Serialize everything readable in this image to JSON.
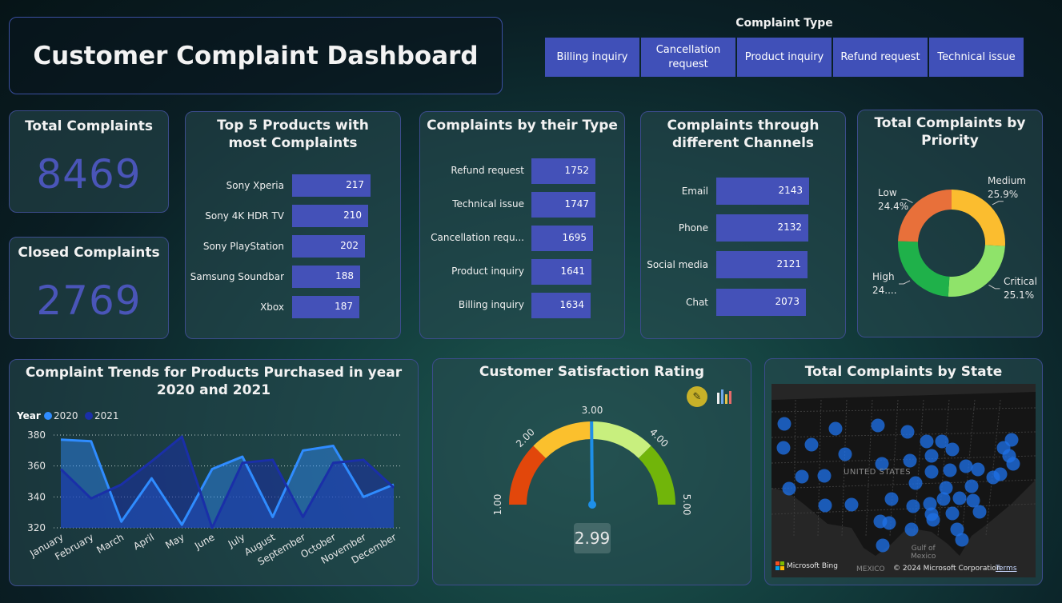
{
  "header": {
    "title": "Customer Complaint Dashboard"
  },
  "slicer": {
    "title": "Complaint Type",
    "options": [
      "Billing inquiry",
      "Cancellation request",
      "Product inquiry",
      "Refund request",
      "Technical issue"
    ]
  },
  "kpis": {
    "total": {
      "title": "Total Complaints",
      "value": "8469"
    },
    "closed": {
      "title": "Closed Complaints",
      "value": "2769"
    }
  },
  "top_products": {
    "title": "Top 5 Products with most Complaints",
    "items": [
      {
        "label": "Sony Xperia",
        "value": "217"
      },
      {
        "label": "Sony 4K HDR TV",
        "value": "210"
      },
      {
        "label": "Sony PlayStation",
        "value": "202"
      },
      {
        "label": "Samsung Soundbar",
        "value": "188"
      },
      {
        "label": "Xbox",
        "value": "187"
      }
    ]
  },
  "by_type": {
    "title": "Complaints by their Type",
    "items": [
      {
        "label": "Refund request",
        "value": "1752"
      },
      {
        "label": "Technical issue",
        "value": "1747"
      },
      {
        "label": "Cancellation requ...",
        "value": "1695"
      },
      {
        "label": "Product inquiry",
        "value": "1641"
      },
      {
        "label": "Billing inquiry",
        "value": "1634"
      }
    ]
  },
  "by_channel": {
    "title": "Complaints through different Channels",
    "items": [
      {
        "label": "Email",
        "value": "2143"
      },
      {
        "label": "Phone",
        "value": "2132"
      },
      {
        "label": "Social media",
        "value": "2121"
      },
      {
        "label": "Chat",
        "value": "2073"
      }
    ]
  },
  "priority": {
    "title": "Total Complaints by Priority",
    "slices": [
      {
        "name": "Medium",
        "pct": "25.9%",
        "share": 25.9,
        "color": "#fbbd2f"
      },
      {
        "name": "Critical",
        "pct": "25.1%",
        "share": 25.1,
        "color": "#8fe36a"
      },
      {
        "name": "High",
        "pct": "24....",
        "share": 24.6,
        "color": "#1fb14a"
      },
      {
        "name": "Low",
        "pct": "24.4%",
        "share": 24.4,
        "color": "#e8703a"
      }
    ]
  },
  "trends": {
    "title": "Complaint Trends for Products Purchased in year 2020 and 2021",
    "legend_title": "Year"
  },
  "chart_data": {
    "type": "area",
    "title": "Complaint Trends for Products Purchased in year 2020 and 2021",
    "x": [
      "January",
      "February",
      "March",
      "April",
      "May",
      "June",
      "July",
      "August",
      "September",
      "October",
      "November",
      "December"
    ],
    "yticks": [
      "380",
      "360",
      "340",
      "320"
    ],
    "ylim": [
      320,
      380
    ],
    "grid": true,
    "legend_placement": "top-left",
    "series": [
      {
        "name": "2020",
        "color": "#2f8cff",
        "values": [
          377,
          376,
          324,
          352,
          322,
          358,
          366,
          327,
          370,
          373,
          340,
          348
        ]
      },
      {
        "name": "2021",
        "color": "#1a2fa8",
        "values": [
          358,
          339,
          348,
          363,
          379,
          320,
          362,
          364,
          327,
          362,
          364,
          346
        ]
      }
    ]
  },
  "gauge": {
    "title": "Customer Satisfaction Rating",
    "value": 2.99,
    "value_label": "2.99",
    "min": 1,
    "max": 5,
    "ticks": [
      "1.00",
      "2.00",
      "3.00",
      "4.00",
      "5.00"
    ],
    "segment_colors": [
      "#e2470b",
      "#fbc02d",
      "#c8ef7e",
      "#71b50a"
    ],
    "needle_color": "#1e8fe8"
  },
  "map": {
    "title": "Total Complaints by State",
    "country_label": "UNITED STATES",
    "gulf_label_1": "Gulf of",
    "gulf_label_2": "Mexico",
    "mexico_label": "MEXICO",
    "bing": "Microsoft Bing",
    "copyright": "© 2024 Microsoft Corporation",
    "terms": "Terms"
  }
}
